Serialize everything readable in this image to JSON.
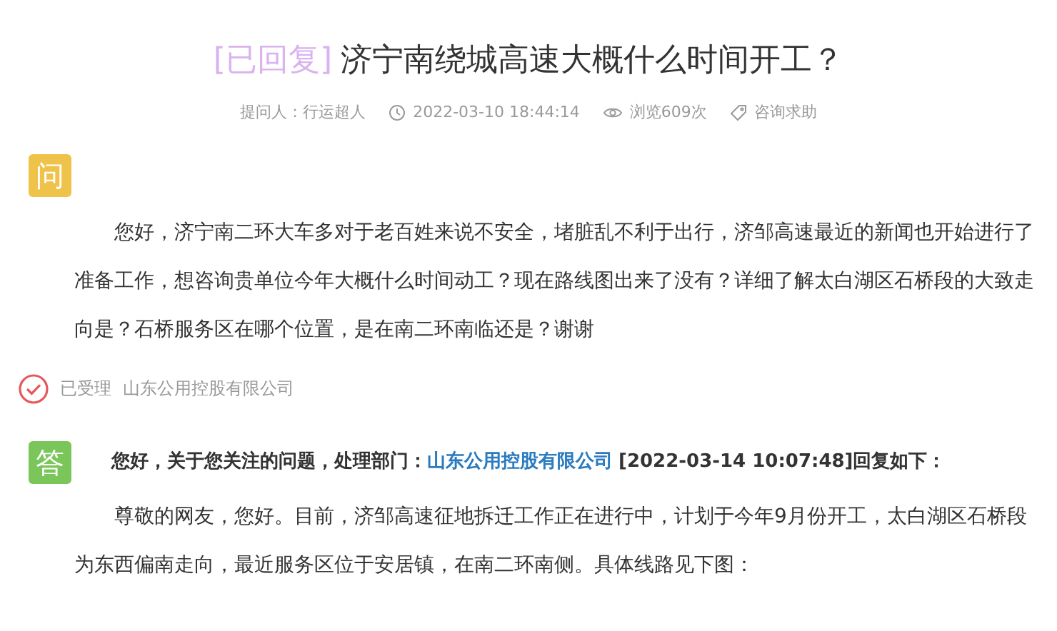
{
  "title": {
    "status": "[已回复]",
    "text": "济宁南绕城高速大概什么时间开工？"
  },
  "meta": {
    "asker": "提问人：行运超人",
    "time": "2022-03-10 18:44:14",
    "views": "浏览609次",
    "category": "咨询求助"
  },
  "question": {
    "badge": "问",
    "text": "您好，济宁南二环大车多对于老百姓来说不安全，堵脏乱不利于出行，济邹高速最近的新闻也开始进行了准备工作，想咨询贵单位今年大概什么时间动工？现在路线图出来了没有？详细了解太白湖区石桥段的大致走向是？石桥服务区在哪个位置，是在南二环南临还是？谢谢"
  },
  "status": {
    "state": "已受理",
    "org": "山东公用控股有限公司"
  },
  "answer": {
    "badge": "答",
    "intro": "您好，关于您关注的问题，处理部门：",
    "department": "山东公用控股有限公司",
    "suffix": "[2022-03-14 10:07:48]回复如下：",
    "text": "尊敬的网友，您好。目前，济邹高速征地拆迁工作正在进行中，计划于今年9月份开工，太白湖区石桥段为东西偏南走向，最近服务区位于安居镇，在南二环南侧。具体线路见下图："
  }
}
